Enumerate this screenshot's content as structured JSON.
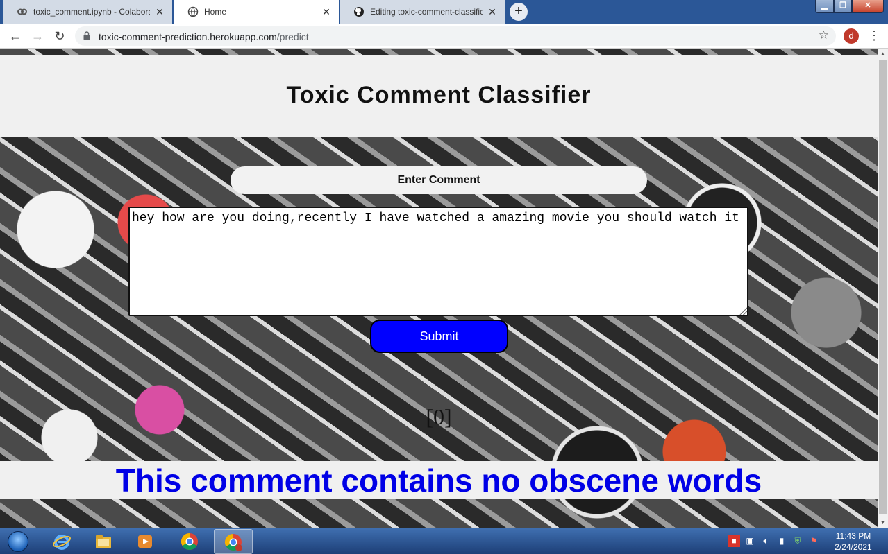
{
  "browser": {
    "tabs": [
      {
        "label": "toxic_comment.ipynb - Colaborat",
        "state": "inactive"
      },
      {
        "label": "Home",
        "state": "active"
      },
      {
        "label": "Editing toxic-comment-classifier/",
        "state": "inactive"
      }
    ],
    "url_host": "toxic-comment-prediction.herokuapp.com",
    "url_path": "/predict",
    "profile_initial": "d"
  },
  "page": {
    "title": "Toxic Comment Classifier",
    "comment_label": "Enter Comment",
    "comment_text": "hey how are you doing,recently I have watched a amazing movie you should watch it ",
    "submit_label": "Submit",
    "prediction": "[0]",
    "result_message": "This comment contains no obscene words",
    "colors": {
      "submit_bg": "#0000ff",
      "result_text": "#0000e6"
    }
  },
  "taskbar": {
    "apps": [
      "internet-explorer",
      "file-explorer",
      "media-player",
      "chrome",
      "chrome-profile"
    ],
    "clock_time": "11:43 PM",
    "clock_date": "2/24/2021"
  }
}
